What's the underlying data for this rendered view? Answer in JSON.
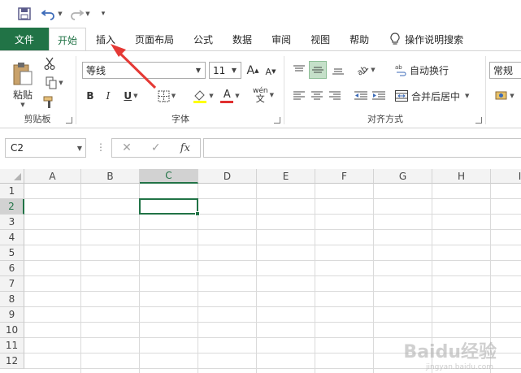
{
  "ribbon_tabs": [
    {
      "label": "文件"
    },
    {
      "label": "开始"
    },
    {
      "label": "插入"
    },
    {
      "label": "页面布局"
    },
    {
      "label": "公式"
    },
    {
      "label": "数据"
    },
    {
      "label": "审阅"
    },
    {
      "label": "视图"
    },
    {
      "label": "帮助"
    }
  ],
  "tell_me": "操作说明搜索",
  "clipboard": {
    "paste_label": "粘贴",
    "group_label": "剪贴板"
  },
  "font": {
    "font_name": "等线",
    "font_size": "11",
    "bold": "B",
    "italic": "I",
    "underline": "U",
    "group_label": "字体"
  },
  "alignment": {
    "wrap_text": "自动换行",
    "merge_center": "合并后居中",
    "group_label": "对齐方式"
  },
  "number": {
    "format": "常规"
  },
  "formula_bar": {
    "name_box": "C2",
    "formula": ""
  },
  "columns": [
    "A",
    "B",
    "C",
    "D",
    "E",
    "F",
    "G",
    "H",
    "I"
  ],
  "rows": [
    "1",
    "2",
    "3",
    "4",
    "5",
    "6",
    "7",
    "8",
    "9",
    "10",
    "11",
    "12"
  ],
  "active_cell": "C2",
  "watermark": {
    "text": "Baidu经验",
    "sub": "jingyan.baidu.com"
  },
  "colors": {
    "accent": "#217346",
    "annotation_arrow": "#e53935"
  }
}
